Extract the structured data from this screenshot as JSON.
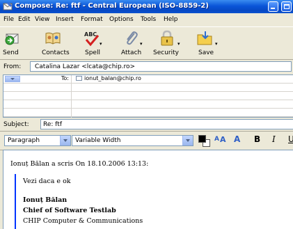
{
  "window": {
    "title": "Compose: Re: ftf - Central European (ISO-8859-2)",
    "icon": "compose-envelope-icon"
  },
  "menu": [
    "File",
    "Edit",
    "View",
    "Insert",
    "Format",
    "Options",
    "Tools",
    "Help"
  ],
  "toolbar": {
    "send": "Send",
    "contacts": "Contacts",
    "spell": "Spell",
    "attach": "Attach",
    "security": "Security",
    "save": "Save",
    "spell_icon_text": "ABC"
  },
  "from": {
    "label": "From:",
    "value": "Catalina Lazar <lcata@chip.ro>"
  },
  "recipients": [
    {
      "type": "To:",
      "address": "ionut_balan@chip.ro"
    }
  ],
  "subject": {
    "label": "Subject:",
    "value": "Re: ftf"
  },
  "format_bar": {
    "paragraph_style": "Paragraph",
    "font": "Variable Width",
    "bold": "B",
    "italic": "I",
    "underline": "U",
    "smaller": "A",
    "larger": "A",
    "text_color": "#000000"
  },
  "message": {
    "reply_header": "Ionuț Bălan a scris On 18.10.2006 13:13:",
    "quoted": {
      "line1": "Vezi daca e ok",
      "name": "Ionuț Bălan",
      "role": "Chief of Software Testlab",
      "company": "CHIP Computer & Communications"
    }
  },
  "colors": {
    "titlebar": "#0a55d8",
    "chrome": "#ece9d8",
    "quote_bar": "#0033ff"
  }
}
